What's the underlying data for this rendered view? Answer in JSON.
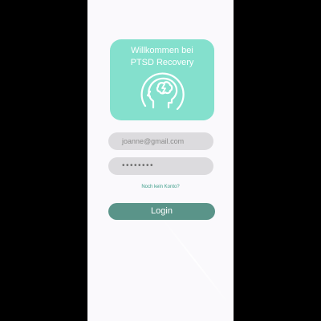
{
  "header": {
    "title_line1": "Willkommen bei",
    "title_line2": "PTSD Recovery",
    "icon": "brain-head-icon"
  },
  "login_form": {
    "email_value": "joanne@gmail.com",
    "password_value": "••••••••",
    "signup_link_label": "Noch kein Konto?",
    "login_button_label": "Login"
  },
  "colors": {
    "screen_background": "#faf9fc",
    "header_card": "#84e0cd",
    "input_background": "#dcdbde",
    "link": "#3b9c88",
    "login_button": "#5a9489"
  }
}
